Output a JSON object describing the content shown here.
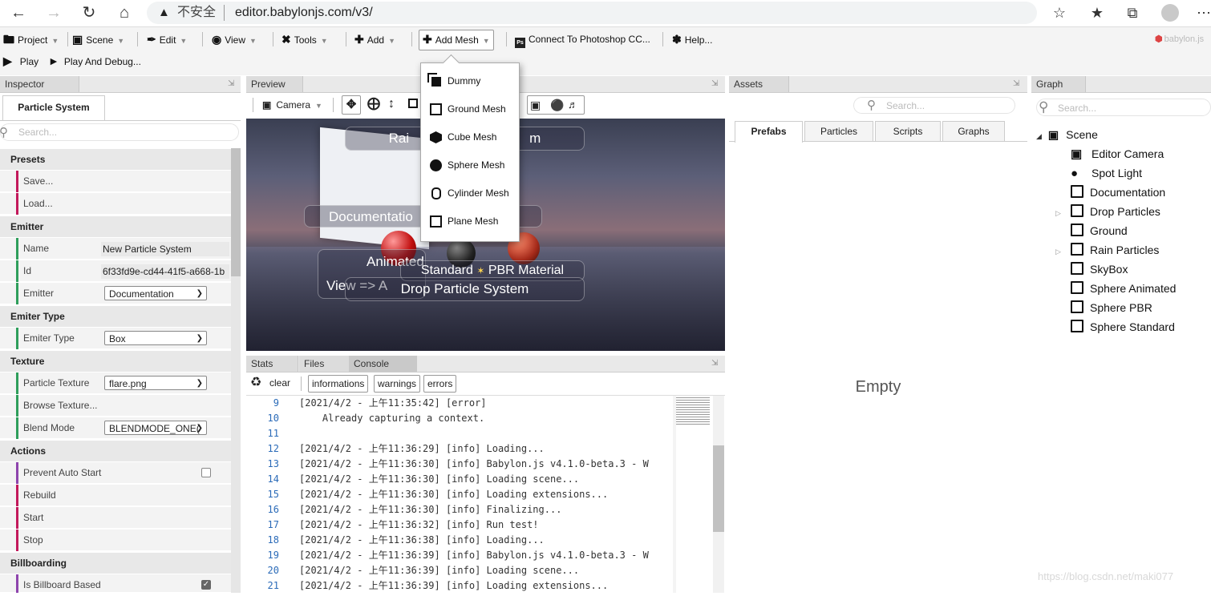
{
  "browser": {
    "warning": "不安全",
    "url": "editor.babylonjs.com/v3/"
  },
  "toolbar": {
    "project": "Project",
    "scene": "Scene",
    "edit": "Edit",
    "view": "View",
    "tools": "Tools",
    "add": "Add",
    "add_mesh": "Add Mesh",
    "photoshop": "Connect To Photoshop CC...",
    "help": "Help...",
    "logo": "babylon.js",
    "play": "Play",
    "play_debug": "Play And Debug..."
  },
  "add_mesh_menu": [
    "Dummy",
    "Ground Mesh",
    "Cube Mesh",
    "Sphere Mesh",
    "Cylinder Mesh",
    "Plane Mesh"
  ],
  "inspector": {
    "header": "Inspector",
    "tab": "Particle System",
    "search_placeholder": "Search...",
    "sections": {
      "presets": "Presets",
      "emitter": "Emitter",
      "emitter_type": "Emiter Type",
      "texture": "Texture",
      "actions": "Actions",
      "billboarding": "Billboarding"
    },
    "rows": {
      "save": "Save...",
      "load": "Load...",
      "name_label": "Name",
      "name_value": "New Particle System",
      "id_label": "Id",
      "id_value": "6f33fd9e-cd44-41f5-a668-1b",
      "emitter_label": "Emitter",
      "emitter_value": "Documentation",
      "emiter_type_label": "Emiter Type",
      "emiter_type_value": "Box",
      "particle_texture_label": "Particle Texture",
      "particle_texture_value": "flare.png",
      "browse_texture": "Browse Texture...",
      "blend_mode_label": "Blend Mode",
      "blend_mode_value": "BLENDMODE_ONE(",
      "prevent_auto_start": "Prevent Auto Start",
      "prevent_auto_start_checked": false,
      "rebuild": "Rebuild",
      "start": "Start",
      "stop": "Stop",
      "billboard_based": "Is Billboard Based",
      "billboard_based_checked": true
    }
  },
  "preview": {
    "header": "Preview",
    "camera": "Camera",
    "overlay": {
      "rain": "Rai",
      "rain_tail": "m",
      "documentation": "Documentatio",
      "animated": "Animated",
      "view": "View => A",
      "standard": "Standard",
      "pbr": "PBR Material",
      "drop": "Drop Particle System"
    }
  },
  "console": {
    "tabs": [
      "Stats",
      "Files",
      "Console"
    ],
    "clear": "clear",
    "filters": [
      "informations",
      "warnings",
      "errors"
    ],
    "lines": [
      {
        "n": "9",
        "t": "[2021/4/2 - 上午11:35:42] [error]"
      },
      {
        "n": "10",
        "t": "    Already capturing a context."
      },
      {
        "n": "11",
        "t": ""
      },
      {
        "n": "12",
        "t": "[2021/4/2 - 上午11:36:29] [info] Loading..."
      },
      {
        "n": "13",
        "t": "[2021/4/2 - 上午11:36:30] [info] Babylon.js v4.1.0-beta.3 - W"
      },
      {
        "n": "14",
        "t": "[2021/4/2 - 上午11:36:30] [info] Loading scene..."
      },
      {
        "n": "15",
        "t": "[2021/4/2 - 上午11:36:30] [info] Loading extensions..."
      },
      {
        "n": "16",
        "t": "[2021/4/2 - 上午11:36:30] [info] Finalizing..."
      },
      {
        "n": "17",
        "t": "[2021/4/2 - 上午11:36:32] [info] Run test!"
      },
      {
        "n": "18",
        "t": "[2021/4/2 - 上午11:36:38] [info] Loading..."
      },
      {
        "n": "19",
        "t": "[2021/4/2 - 上午11:36:39] [info] Babylon.js v4.1.0-beta.3 - W"
      },
      {
        "n": "20",
        "t": "[2021/4/2 - 上午11:36:39] [info] Loading scene..."
      },
      {
        "n": "21",
        "t": "[2021/4/2 - 上午11:36:39] [info] Loading extensions..."
      }
    ]
  },
  "assets": {
    "header": "Assets",
    "search_placeholder": "Search...",
    "tabs": [
      "Prefabs",
      "Particles",
      "Scripts",
      "Graphs"
    ],
    "empty": "Empty"
  },
  "graph": {
    "header": "Graph",
    "search_placeholder": "Search...",
    "root": "Scene",
    "nodes": [
      {
        "label": "Editor Camera",
        "icon": "camera-icon",
        "expandable": false
      },
      {
        "label": "Spot Light",
        "icon": "lightbulb-icon",
        "expandable": false
      },
      {
        "label": "Documentation",
        "icon": "mesh-icon",
        "expandable": false
      },
      {
        "label": "Drop Particles",
        "icon": "mesh-icon",
        "expandable": true
      },
      {
        "label": "Ground",
        "icon": "mesh-icon",
        "expandable": false
      },
      {
        "label": "Rain Particles",
        "icon": "mesh-icon",
        "expandable": true
      },
      {
        "label": "SkyBox",
        "icon": "mesh-icon",
        "expandable": false
      },
      {
        "label": "Sphere Animated",
        "icon": "mesh-icon",
        "expandable": false
      },
      {
        "label": "Sphere PBR",
        "icon": "mesh-icon",
        "expandable": false
      },
      {
        "label": "Sphere Standard",
        "icon": "mesh-icon",
        "expandable": false
      }
    ]
  },
  "watermark": "https://blog.csdn.net/maki077"
}
